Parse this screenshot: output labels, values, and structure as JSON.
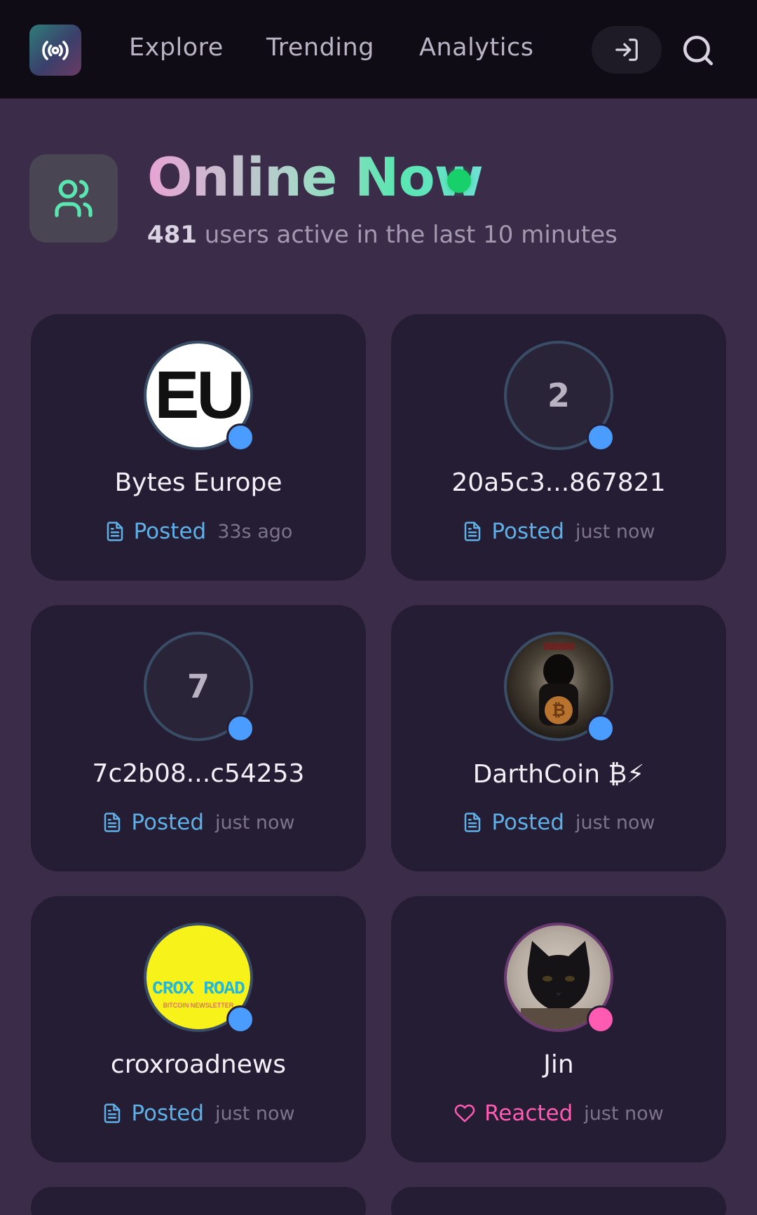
{
  "nav": {
    "links": [
      "Explore",
      "Trending",
      "Analytics"
    ]
  },
  "header": {
    "title": "Online Now",
    "count": "481",
    "subtitle": "users active in the last 10 minutes"
  },
  "users": [
    {
      "name": "Bytes Europe",
      "avatar_text": "EU",
      "action": "Posted",
      "time": "33s ago",
      "status_color": "#4a9dff"
    },
    {
      "name": "20a5c3...867821",
      "avatar_text": "2",
      "action": "Posted",
      "time": "just now",
      "status_color": "#4a9dff"
    },
    {
      "name": "7c2b08...c54253",
      "avatar_text": "7",
      "action": "Posted",
      "time": "just now",
      "status_color": "#4a9dff"
    },
    {
      "name": "DarthCoin ₿⚡",
      "avatar_text": "",
      "action": "Posted",
      "time": "just now",
      "status_color": "#4a9dff"
    },
    {
      "name": "croxroadnews",
      "avatar_text": "CROX ROAD",
      "avatar_subtext": "BITCOIN NEWSLETTER",
      "action": "Posted",
      "time": "just now",
      "status_color": "#4a9dff"
    },
    {
      "name": "Jin",
      "avatar_text": "",
      "action": "Reacted",
      "time": "just now",
      "status_color": "#ff5bb2"
    }
  ],
  "colors": {
    "background": "#3b2c4a",
    "card": "#241d33",
    "posted": "#5eb0e6",
    "reacted": "#ff5bb2",
    "online": "#18d06a"
  }
}
